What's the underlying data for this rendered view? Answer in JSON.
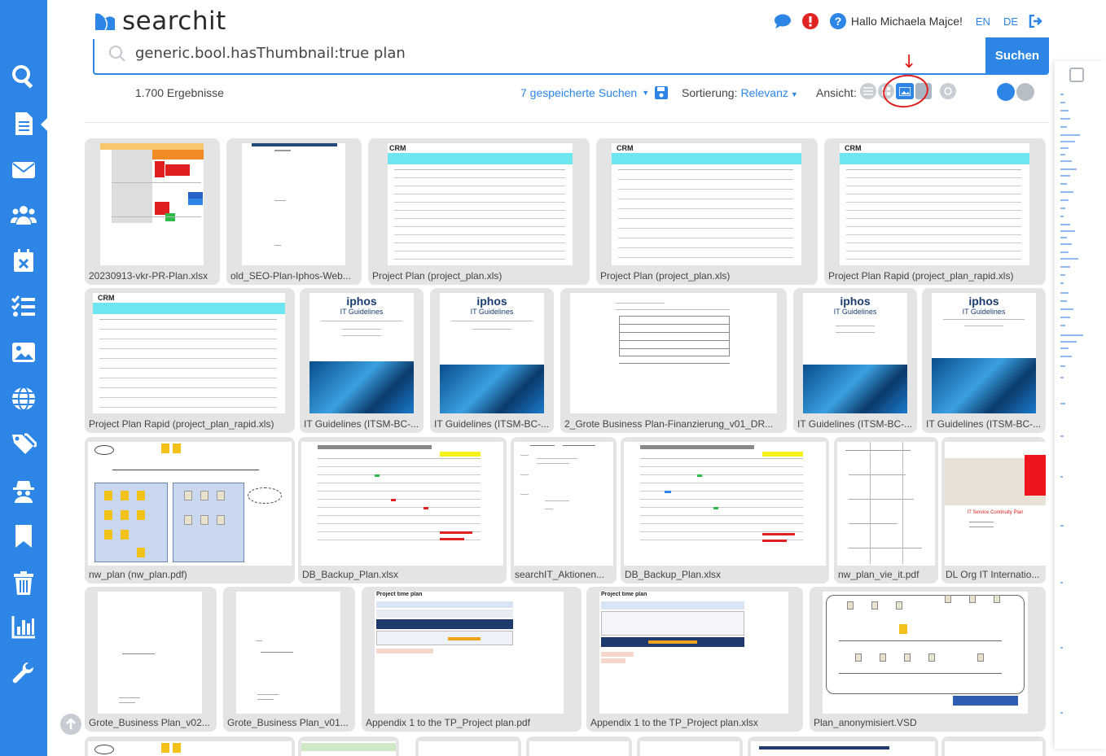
{
  "app": {
    "logo_text": "searchit"
  },
  "header": {
    "greeting": "Hallo Michaela Majce!",
    "lang_en": "EN",
    "lang_de": "DE"
  },
  "search": {
    "query": "generic.bool.hasThumbnail:true plan",
    "button_label": "Suchen"
  },
  "results": {
    "count_label": "1.700 Ergebnisse",
    "saved_searches": "7 gespeicherte Suchen",
    "sort_label": "Sortierung:",
    "sort_value": "Relevanz",
    "view_label": "Ansicht:"
  },
  "sidebar": {
    "items": [
      "search",
      "documents",
      "mail",
      "people",
      "calendar",
      "tasks",
      "images",
      "web",
      "tags",
      "spy",
      "bookmarks",
      "trash",
      "reports",
      "settings"
    ]
  },
  "tiles": [
    {
      "caption": "20230913-vkr-PR-Plan.xlsx"
    },
    {
      "caption": "old_SEO-Plan-Iphos-Web..."
    },
    {
      "caption": "Project Plan (project_plan.xls)"
    },
    {
      "caption": "Project Plan (project_plan.xls)"
    },
    {
      "caption": "Project Plan Rapid (project_plan_rapid.xls)"
    },
    {
      "caption": "Project Plan Rapid (project_plan_rapid.xls)"
    },
    {
      "caption": "IT Guidelines (ITSM-BC-..."
    },
    {
      "caption": "IT Guidelines (ITSM-BC-..."
    },
    {
      "caption": "2_Grote Business Plan-Finanzierung_v01_DR..."
    },
    {
      "caption": "IT Guidelines (ITSM-BC-..."
    },
    {
      "caption": "IT Guidelines (ITSM-BC-..."
    },
    {
      "caption": "nw_plan (nw_plan.pdf)"
    },
    {
      "caption": "DB_Backup_Plan.xlsx"
    },
    {
      "caption": "searchIT_Aktionen..."
    },
    {
      "caption": "DB_Backup_Plan.xlsx"
    },
    {
      "caption": "nw_plan_vie_it.pdf"
    },
    {
      "caption": "DL Org IT Internatio..."
    },
    {
      "caption": "Grote_Business Plan_v02..."
    },
    {
      "caption": "Grote_Business Plan_v01..."
    },
    {
      "caption": "Appendix 1 to the TP_Project plan.pdf"
    },
    {
      "caption": "Appendix 1 to the TP_Project plan.xlsx"
    },
    {
      "caption": "Plan_anonymisiert.VSD"
    }
  ],
  "thumb_text": {
    "crm": "CRM",
    "iphos": "iphos",
    "it_guidelines": "IT Guidelines",
    "project_time_plan": "Project time plan",
    "continuity": "IT Service Continuity Plan"
  },
  "colors": {
    "brand": "#2d86e6",
    "sidebar": "#2d86e6",
    "annotation_red": "#e01d1d",
    "tile_bg": "#e4e4e4"
  }
}
